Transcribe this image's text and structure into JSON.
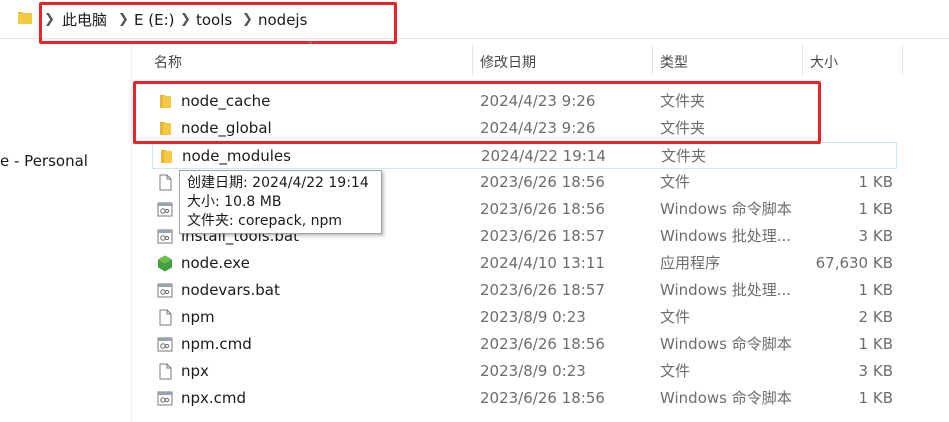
{
  "address_bar": {
    "crumbs": [
      "此电脑",
      "E (E:)",
      "tools",
      "nodejs"
    ],
    "separator": ">"
  },
  "nav": {
    "partial_item": "e - Personal"
  },
  "columns": {
    "name": "名称",
    "date": "修改日期",
    "type": "类型",
    "size": "大小",
    "sort_indicator": "^"
  },
  "files": [
    {
      "name": "node_cache",
      "date": "2024/4/23 9:26",
      "type": "文件夹",
      "size": "",
      "icon": "folder-icon"
    },
    {
      "name": "node_global",
      "date": "2024/4/23 9:26",
      "type": "文件夹",
      "size": "",
      "icon": "folder-icon"
    },
    {
      "name": "node_modules",
      "date": "2024/4/22 19:14",
      "type": "文件夹",
      "size": "",
      "icon": "folder-icon"
    },
    {
      "name": "",
      "date": "2023/6/26 18:56",
      "type": "文件",
      "size": "1 KB",
      "icon": "file-icon"
    },
    {
      "name": "",
      "date": "2023/6/26 18:56",
      "type": "Windows 命令脚本",
      "size": "1 KB",
      "icon": "script-icon"
    },
    {
      "name": "install_tools.bat",
      "date": "2023/6/26 18:57",
      "type": "Windows 批处理...",
      "size": "3 KB",
      "icon": "script-icon"
    },
    {
      "name": "node.exe",
      "date": "2024/4/10 13:11",
      "type": "应用程序",
      "size": "67,630 KB",
      "icon": "nodejs-icon"
    },
    {
      "name": "nodevars.bat",
      "date": "2023/6/26 18:57",
      "type": "Windows 批处理...",
      "size": "1 KB",
      "icon": "script-icon"
    },
    {
      "name": "npm",
      "date": "2023/8/9 0:23",
      "type": "文件",
      "size": "2 KB",
      "icon": "file-icon"
    },
    {
      "name": "npm.cmd",
      "date": "2023/6/26 18:56",
      "type": "Windows 命令脚本",
      "size": "1 KB",
      "icon": "script-icon"
    },
    {
      "name": "npx",
      "date": "2023/8/9 0:23",
      "type": "文件",
      "size": "3 KB",
      "icon": "file-icon"
    },
    {
      "name": "npx.cmd",
      "date": "2023/6/26 18:56",
      "type": "Windows 命令脚本",
      "size": "1 KB",
      "icon": "script-icon"
    }
  ],
  "tooltip": {
    "created": "创建日期: 2024/4/22 19:14",
    "size": "大小: 10.8 MB",
    "contents": "文件夹: corepack, npm"
  },
  "colors": {
    "highlight": "#e8242a",
    "folder": "#f5c842",
    "node_green": "#44a044",
    "hover_border": "#cde8f4"
  }
}
